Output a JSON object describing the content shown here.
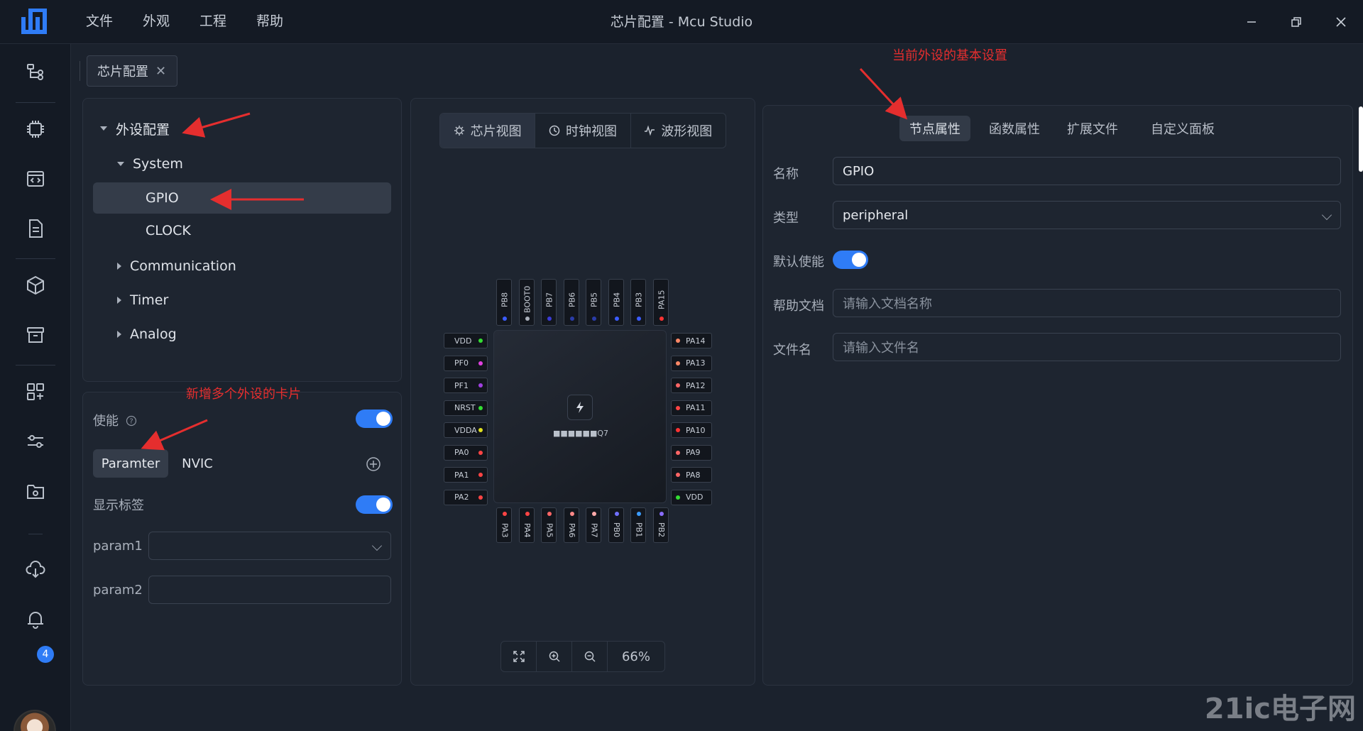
{
  "window": {
    "title": "芯片配置 - Mcu Studio"
  },
  "menu": [
    "文件",
    "外观",
    "工程",
    "帮助"
  ],
  "notifications": {
    "count": "4"
  },
  "tab": {
    "label": "芯片配置"
  },
  "tree": {
    "root": "外设配置",
    "system": "System",
    "gpio": "GPIO",
    "clock": "CLOCK",
    "communication": "Communication",
    "timer": "Timer",
    "analog": "Analog"
  },
  "settings": {
    "enable_label": "使能",
    "tab_parameter": "Paramter",
    "tab_nvic": "NVIC",
    "show_label": "显示标签",
    "param1_label": "param1",
    "param2_label": "param2"
  },
  "views": [
    "芯片视图",
    "时钟视图",
    "波形视图"
  ],
  "chip": {
    "name": "■■■■■■Q7",
    "pins_top": [
      {
        "name": "PB8",
        "color": "#3b5cff"
      },
      {
        "name": "BOOT0",
        "color": "#aab0bb"
      },
      {
        "name": "PB7",
        "color": "#3b3bd6"
      },
      {
        "name": "PB6",
        "color": "#2a3ca8"
      },
      {
        "name": "PB5",
        "color": "#2a3ca8"
      },
      {
        "name": "PB4",
        "color": "#3b5cff"
      },
      {
        "name": "PB3",
        "color": "#3b5cff"
      },
      {
        "name": "PA15",
        "color": "#ff3333"
      }
    ],
    "pins_left": [
      {
        "name": "VDD",
        "color": "#33dd33"
      },
      {
        "name": "PF0",
        "color": "#e040e0"
      },
      {
        "name": "PF1",
        "color": "#a040e0"
      },
      {
        "name": "NRST",
        "color": "#33dd33"
      },
      {
        "name": "VDDA",
        "color": "#e0e020"
      },
      {
        "name": "PA0",
        "color": "#ff4444"
      },
      {
        "name": "PA1",
        "color": "#ff4444"
      },
      {
        "name": "PA2",
        "color": "#ff4444"
      }
    ],
    "pins_right": [
      {
        "name": "PA14",
        "color": "#ff8866"
      },
      {
        "name": "PA13",
        "color": "#ff8866"
      },
      {
        "name": "PA12",
        "color": "#ff6666"
      },
      {
        "name": "PA11",
        "color": "#ff4444"
      },
      {
        "name": "PA10",
        "color": "#ff3333"
      },
      {
        "name": "PA9",
        "color": "#ff6666"
      },
      {
        "name": "PA8",
        "color": "#ff6666"
      },
      {
        "name": "VDD",
        "color": "#33dd33"
      }
    ],
    "pins_bottom": [
      {
        "name": "PA3",
        "color": "#ff4444"
      },
      {
        "name": "PA4",
        "color": "#ff4444"
      },
      {
        "name": "PA5",
        "color": "#ff6666"
      },
      {
        "name": "PA6",
        "color": "#ff8888"
      },
      {
        "name": "PA7",
        "color": "#ffaaaa"
      },
      {
        "name": "PB0",
        "color": "#7070ff"
      },
      {
        "name": "PB1",
        "color": "#3b9cff"
      },
      {
        "name": "PB2",
        "color": "#8a6cff"
      }
    ]
  },
  "zoom": {
    "value": "66%"
  },
  "props_tabs": [
    "节点属性",
    "函数属性",
    "扩展文件",
    "自定义面板"
  ],
  "props": {
    "name_label": "名称",
    "name_value": "GPIO",
    "type_label": "类型",
    "type_value": "peripheral",
    "default_enable_label": "默认使能",
    "help_label": "帮助文档",
    "help_placeholder": "请输入文档名称",
    "filename_label": "文件名",
    "filename_placeholder": "请输入文件名"
  },
  "annotations": {
    "a1": "当前外设的基本设置",
    "a2": "新增多个外设的卡片"
  },
  "watermark": "21ic电子网"
}
